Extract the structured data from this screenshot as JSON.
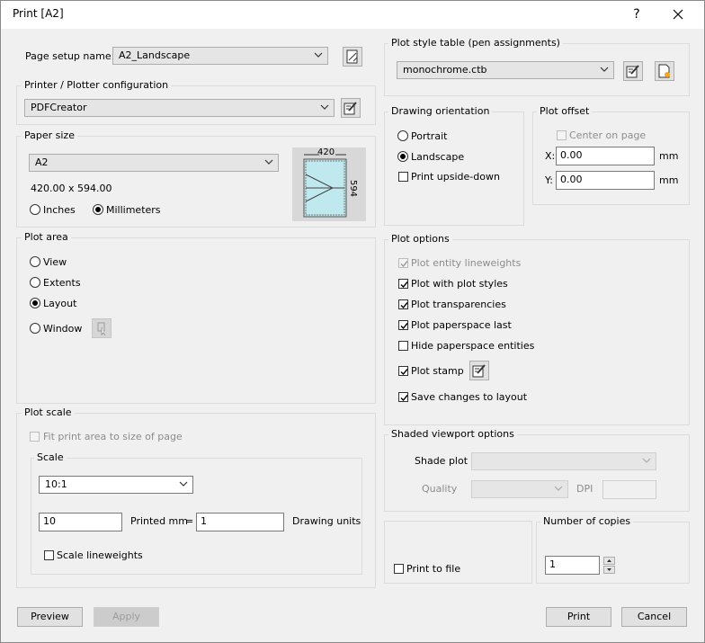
{
  "window": {
    "title": "Print [A2]",
    "help_symbol": "?",
    "close_symbol": "✕"
  },
  "page_setup": {
    "label": "Page setup name:",
    "value": "A2_Landscape"
  },
  "printer": {
    "label": "Printer / Plotter configuration",
    "value": "PDFCreator"
  },
  "paper_size": {
    "label": "Paper size",
    "value": "A2",
    "dimensions": "420.00 x 594.00",
    "inches_label": "Inches",
    "mm_label": "Millimeters",
    "preview_width": "420",
    "preview_height": "594"
  },
  "plot_area": {
    "label": "Plot area",
    "options": [
      "View",
      "Extents",
      "Layout",
      "Window"
    ],
    "selected": "Layout"
  },
  "plot_scale": {
    "label": "Plot scale",
    "fit_label": "Fit print area to size of page",
    "scale_label": "Scale",
    "scale_value": "10:1",
    "printed_value": "10",
    "printed_label": "Printed mm",
    "equals": "=",
    "units_value": "1",
    "units_label": "Drawing units",
    "lineweights_label": "Scale lineweights"
  },
  "plot_style": {
    "label": "Plot style table (pen assignments)",
    "value": "monochrome.ctb"
  },
  "orientation": {
    "label": "Drawing orientation",
    "portrait_label": "Portrait",
    "landscape_label": "Landscape",
    "upside_down_label": "Print upside-down",
    "selected": "Landscape"
  },
  "plot_offset": {
    "label": "Plot offset",
    "center_label": "Center on page",
    "x_label": "X:",
    "x_value": "0.00",
    "y_label": "Y:",
    "y_value": "0.00",
    "unit": "mm"
  },
  "plot_options": {
    "label": "Plot options",
    "entity_lineweights": "Plot entity lineweights",
    "plot_styles": "Plot with plot styles",
    "transparencies": "Plot transparencies",
    "paperspace_last": "Plot paperspace last",
    "hide_paperspace": "Hide paperspace entities",
    "plot_stamp": "Plot stamp",
    "save_changes": "Save changes to layout"
  },
  "shaded": {
    "label": "Shaded viewport options",
    "shade_plot_label": "Shade plot",
    "quality_label": "Quality",
    "dpi_label": "DPI"
  },
  "print_to_file": {
    "label": "Print to file"
  },
  "copies": {
    "label": "Number of copies",
    "value": "1"
  },
  "buttons": {
    "preview": "Preview",
    "apply": "Apply",
    "print": "Print",
    "cancel": "Cancel"
  }
}
